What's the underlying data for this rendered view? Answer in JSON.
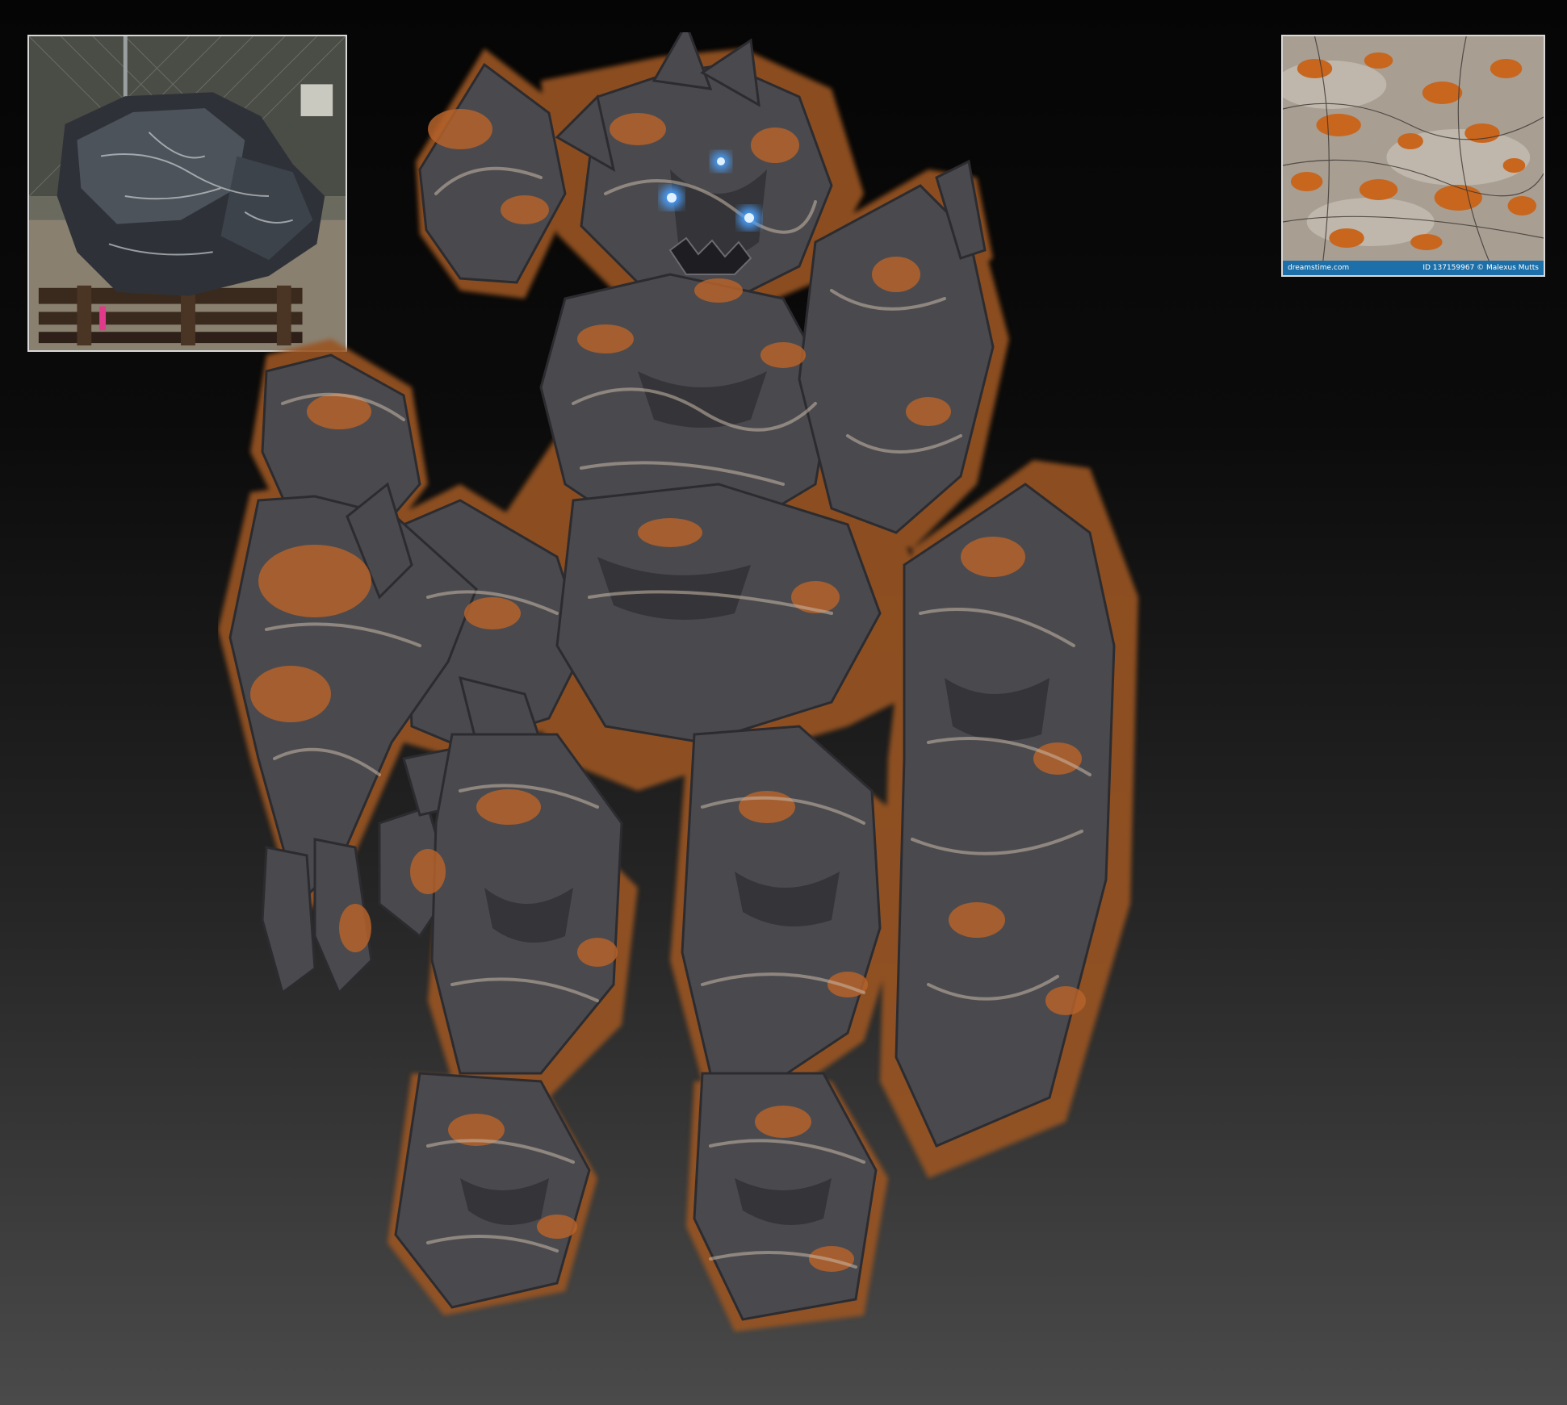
{
  "references": {
    "boulder_photo": {
      "description_icon": "boulder-photo"
    },
    "lichen_photo": {
      "stock_site": "dreamstime.com",
      "stock_credit": "ID 137159967 © Malexus Mutts"
    }
  },
  "colors": {
    "rock": "#4a4a4e",
    "rock_dark": "#2c2c30",
    "rust": "#b5622a",
    "vein": "#c9b8a8",
    "eye_glow": "#4aa0ff",
    "stock_bar": "#1c6fa8"
  }
}
